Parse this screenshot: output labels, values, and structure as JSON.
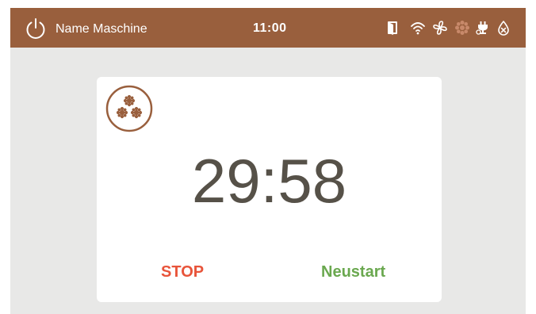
{
  "header": {
    "machine_name": "Name Maschine",
    "time": "11:00",
    "status_icons": [
      "door-icon",
      "wifi-icon",
      "fan-icon",
      "rotor-icon",
      "plug-icon",
      "water-off-icon"
    ]
  },
  "timer": {
    "program_icon": "triple-cluster-icon",
    "remaining": "29:58",
    "stop_label": "STOP",
    "restart_label": "Neustart"
  },
  "colors": {
    "header_bg": "#995f3d",
    "screen_bg": "#e8e8e7",
    "card_bg": "#ffffff",
    "timer_text": "#565148",
    "stop": "#e8543a",
    "restart": "#6aa84f",
    "inactive_icon": "#c8896a"
  }
}
